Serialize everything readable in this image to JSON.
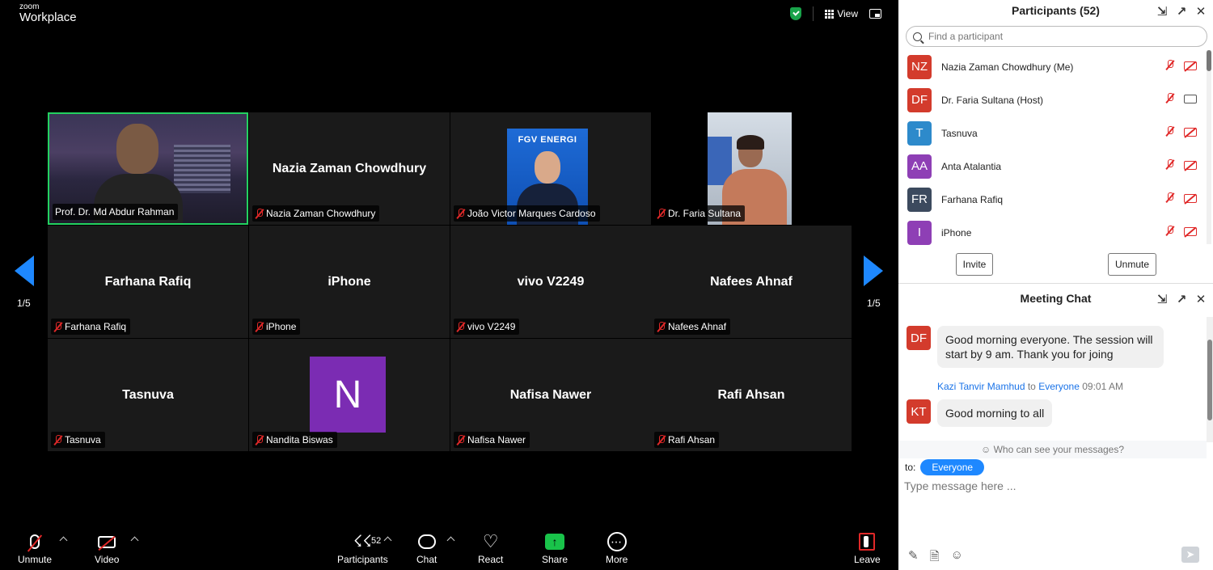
{
  "brand": {
    "top": "zoom",
    "main": "Workplace"
  },
  "topbar": {
    "view_label": "View"
  },
  "tiles": [
    {
      "name": "Prof. Dr. Md Abdur Rahman",
      "center": "",
      "kind": "video"
    },
    {
      "name": "Nazia Zaman Chowdhury",
      "center": "Nazia Zaman Chowdhury",
      "kind": "name"
    },
    {
      "name": "João Victor Marques Cardoso",
      "center": "",
      "kind": "video",
      "banner": "FGV ENERGI"
    },
    {
      "name": "Dr. Faria Sultana",
      "center": "",
      "kind": "video"
    },
    {
      "name": "Farhana Rafiq",
      "center": "Farhana Rafiq",
      "kind": "name"
    },
    {
      "name": "iPhone",
      "center": "iPhone",
      "kind": "name"
    },
    {
      "name": "vivo V2249",
      "center": "vivo V2249",
      "kind": "name"
    },
    {
      "name": "Nafees Ahnaf",
      "center": "Nafees Ahnaf",
      "kind": "name"
    },
    {
      "name": "Tasnuva",
      "center": "Tasnuva",
      "kind": "name"
    },
    {
      "name": "Nandita Biswas",
      "center": "",
      "kind": "avatar",
      "initial": "N"
    },
    {
      "name": "Nafisa Nawer",
      "center": "Nafisa Nawer",
      "kind": "name"
    },
    {
      "name": "Rafi Ahsan",
      "center": "Rafi Ahsan",
      "kind": "name"
    }
  ],
  "pager": {
    "left": "1/5",
    "right": "1/5"
  },
  "toolbar": {
    "unmute": "Unmute",
    "video": "Video",
    "participants": "Participants",
    "participants_count": "52",
    "chat": "Chat",
    "react": "React",
    "share": "Share",
    "more": "More",
    "leave": "Leave"
  },
  "participants_panel": {
    "title": "Participants (52)",
    "search_placeholder": "Find a participant",
    "items": [
      {
        "initials": "NZ",
        "name": "Nazia Zaman Chowdhury (Me)",
        "color": "#d33b2c",
        "cam_off": true
      },
      {
        "initials": "DF",
        "name": "Dr. Faria Sultana (Host)",
        "color": "#d33b2c",
        "cam_off": false
      },
      {
        "initials": "T",
        "name": "Tasnuva",
        "color": "#2d8acb",
        "cam_off": true
      },
      {
        "initials": "AA",
        "name": "Anta Atalantia",
        "color": "#8e3fb5",
        "cam_off": true
      },
      {
        "initials": "FR",
        "name": "Farhana Rafiq",
        "color": "#3c4a5e",
        "cam_off": true
      },
      {
        "initials": "I",
        "name": "iPhone",
        "color": "#8e3fb5",
        "cam_off": true
      }
    ],
    "invite": "Invite",
    "unmute": "Unmute"
  },
  "chat_panel": {
    "title": "Meeting Chat",
    "messages": [
      {
        "initials": "DF",
        "color": "#d33b2c",
        "text": "Good morning everyone. The session will start by 9 am. Thank you for joing"
      },
      {
        "initials": "KT",
        "color": "#d33b2c",
        "text": "Good morning to all"
      }
    ],
    "meta": {
      "sender": "Kazi Tanvir Mamhud",
      "to": "to",
      "recipient": "Everyone",
      "time": "09:01 AM"
    },
    "visibility": "Who can see your messages?",
    "to_label": "to:",
    "to_value": "Everyone",
    "compose_placeholder": "Type message here ..."
  }
}
